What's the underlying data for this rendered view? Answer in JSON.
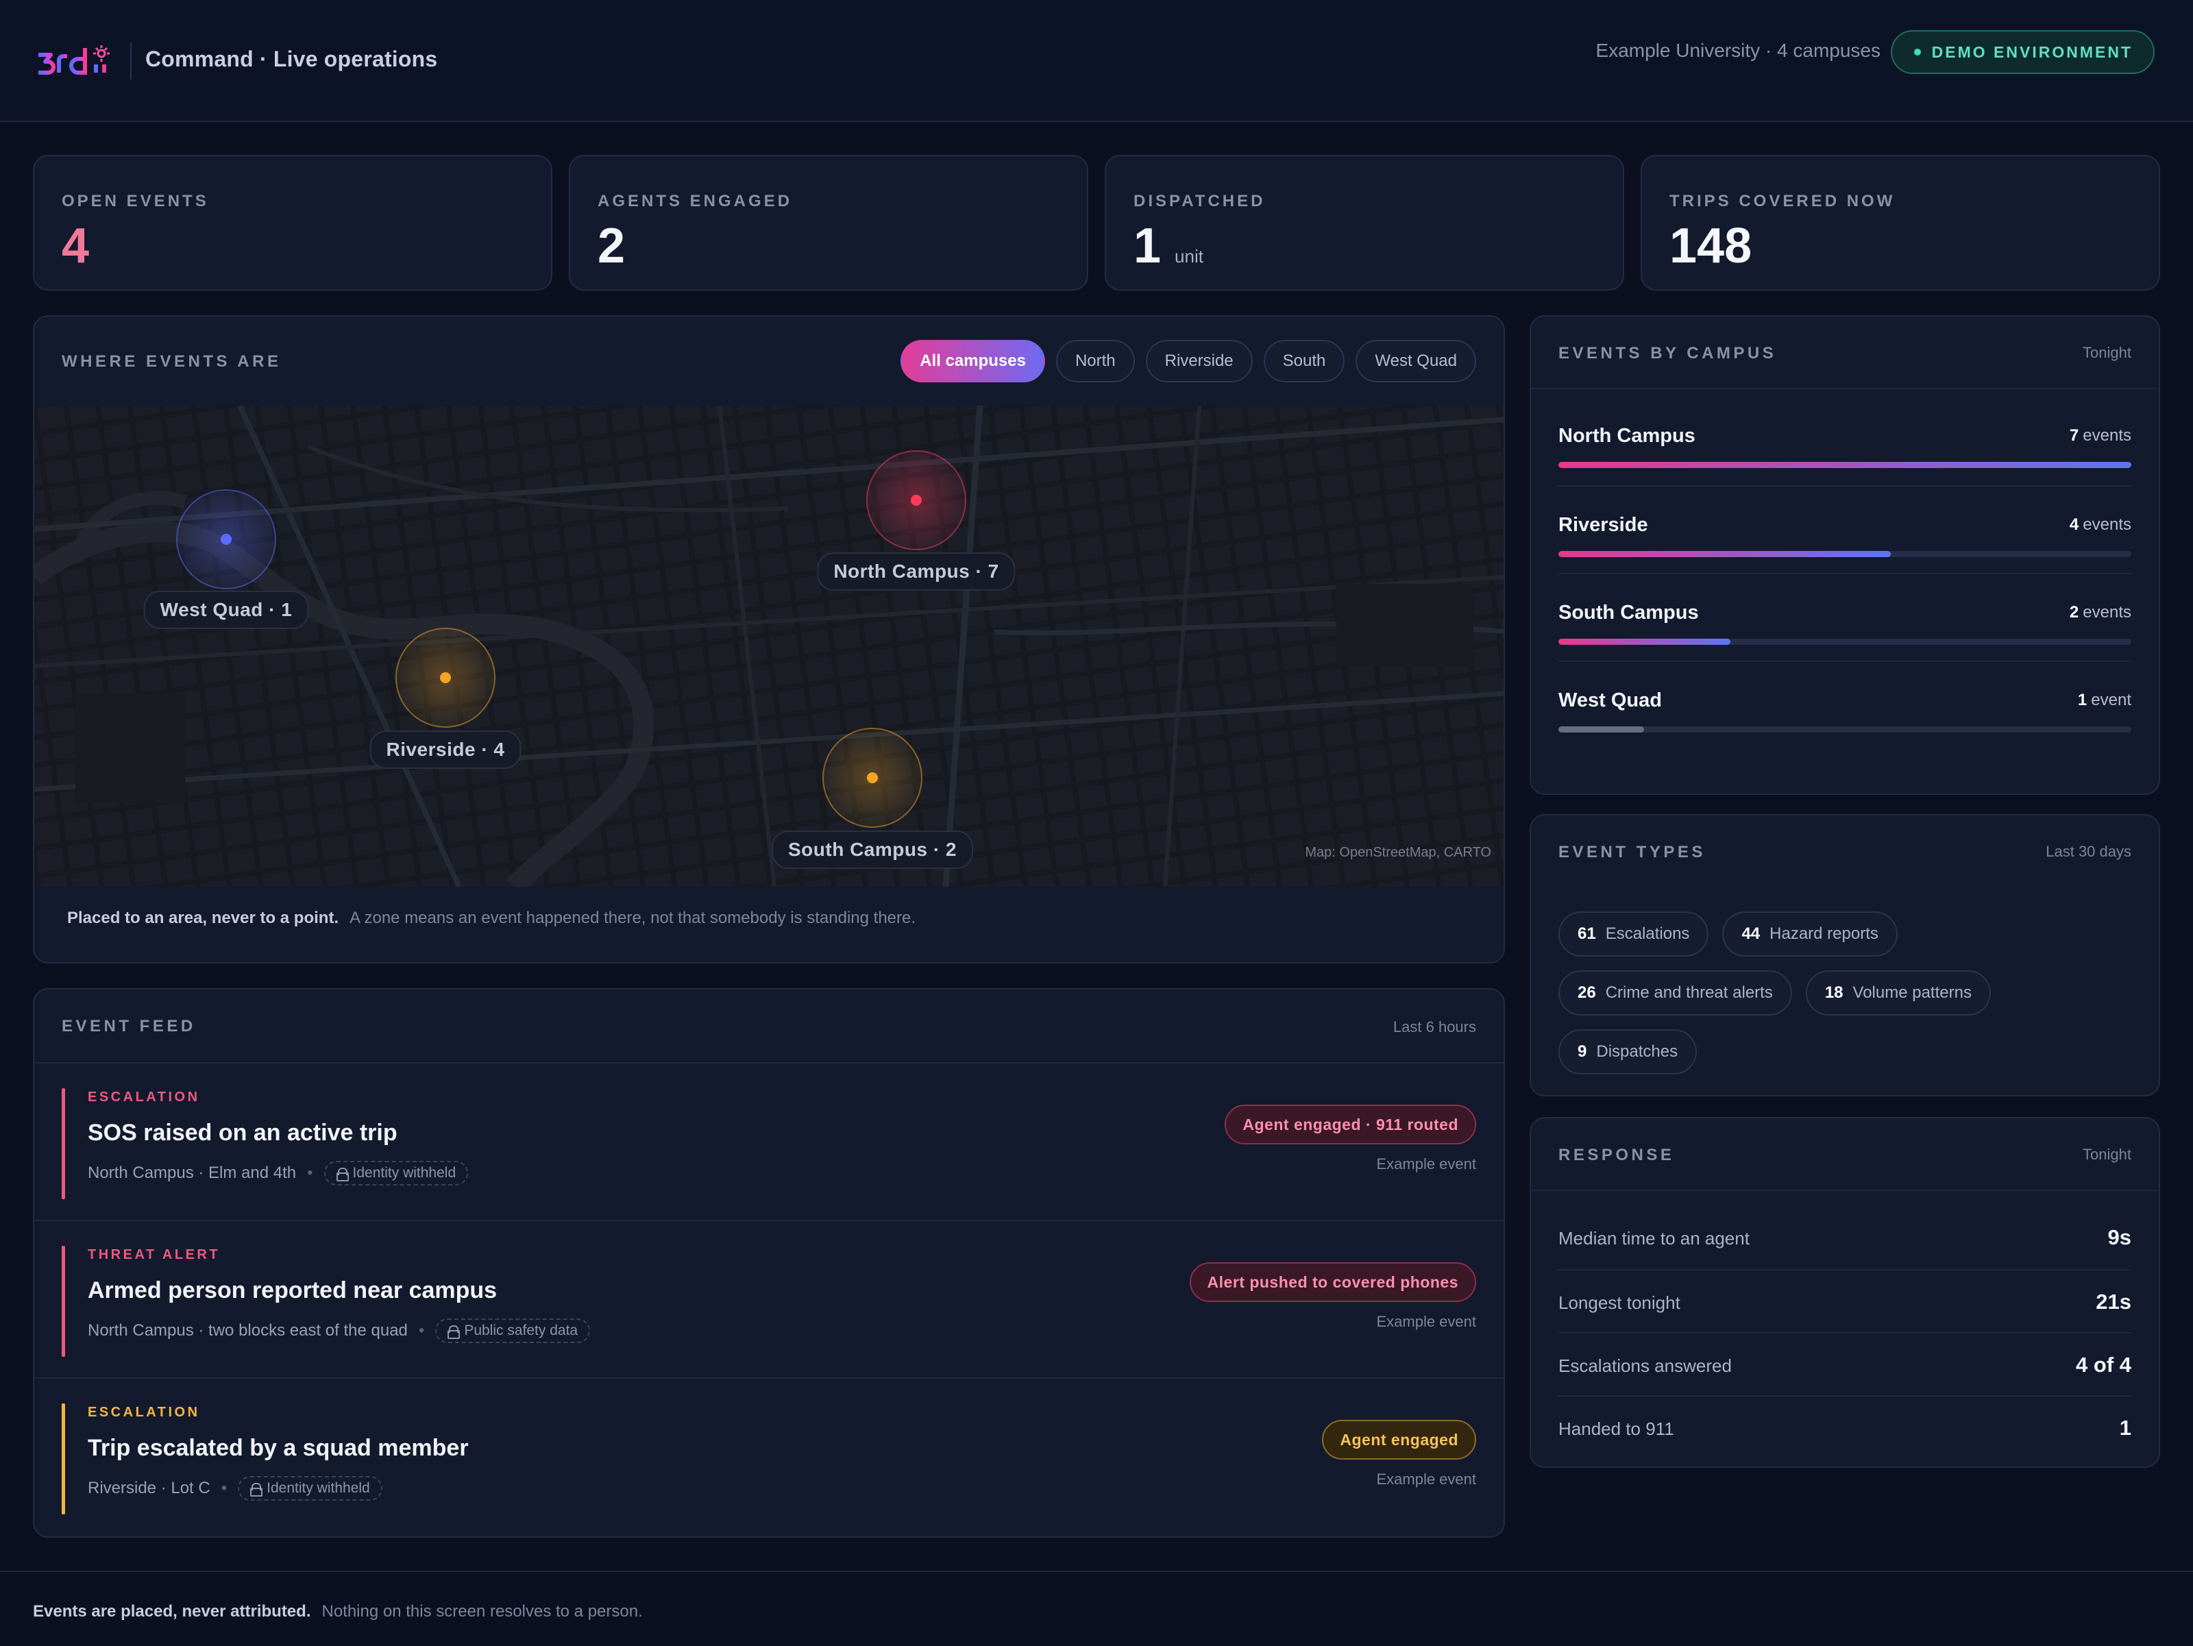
{
  "header": {
    "app_title": "Command · Live operations",
    "org_label": "Example University · 4 campuses",
    "env_badge": "DEMO ENVIRONMENT"
  },
  "kpis": [
    {
      "label": "OPEN EVENTS",
      "value": "4",
      "unit": ""
    },
    {
      "label": "AGENTS ENGAGED",
      "value": "2",
      "unit": ""
    },
    {
      "label": "DISPATCHED",
      "value": "1",
      "unit": "unit"
    },
    {
      "label": "TRIPS COVERED NOW",
      "value": "148",
      "unit": ""
    }
  ],
  "map_section": {
    "title": "WHERE EVENTS ARE",
    "filters": [
      "All campuses",
      "North",
      "Riverside",
      "South",
      "West Quad"
    ],
    "active_filter": "All campuses",
    "zones": [
      {
        "label": "West Quad · 1",
        "color": "#5b6cff"
      },
      {
        "label": "North Campus · 7",
        "color": "#ff3b5c"
      },
      {
        "label": "Riverside · 4",
        "color": "#f5a524"
      },
      {
        "label": "South Campus · 2",
        "color": "#f5a524"
      }
    ],
    "attribution": "Map: OpenStreetMap, CARTO",
    "note_strong": "Placed to an area, never to a point.",
    "note": "A zone means an event happened there, not that somebody is standing there."
  },
  "feed": {
    "title": "EVENT FEED",
    "meta": "Last 6 hours",
    "items": [
      {
        "kind": "ESCALATION",
        "title": "SOS raised on an active trip",
        "location": "North Campus · Elm and 4th",
        "privacy": "Identity withheld",
        "status": "Agent engaged · 911 routed",
        "note": "Example event",
        "accent": "#f0587e"
      },
      {
        "kind": "THREAT ALERT",
        "title": "Armed person reported near campus",
        "location": "North Campus · two blocks east of the quad",
        "privacy": "Public safety data",
        "status": "Alert pushed to covered phones",
        "note": "Example event",
        "accent": "#f0587e"
      },
      {
        "kind": "ESCALATION",
        "title": "Trip escalated by a squad member",
        "location": "Riverside · Lot C",
        "privacy": "Identity withheld",
        "status": "Agent engaged",
        "note": "Example event",
        "accent": "#f5b63f"
      }
    ]
  },
  "by_campus": {
    "title": "EVENTS BY CAMPUS",
    "meta": "Tonight",
    "rows": [
      {
        "name": "North Campus",
        "count": "7",
        "unit": "events",
        "fraction": 1.0
      },
      {
        "name": "Riverside",
        "count": "4",
        "unit": "events",
        "fraction": 0.58
      },
      {
        "name": "South Campus",
        "count": "2",
        "unit": "events",
        "fraction": 0.3
      },
      {
        "name": "West Quad",
        "count": "1",
        "unit": "event",
        "fraction": 0.15
      }
    ]
  },
  "event_types": {
    "title": "EVENT TYPES",
    "meta": "Last 30 days",
    "items": [
      {
        "count": "61",
        "label": "Escalations"
      },
      {
        "count": "44",
        "label": "Hazard reports"
      },
      {
        "count": "26",
        "label": "Crime and threat alerts"
      },
      {
        "count": "18",
        "label": "Volume patterns"
      },
      {
        "count": "9",
        "label": "Dispatches"
      }
    ]
  },
  "response": {
    "title": "RESPONSE",
    "meta": "Tonight",
    "rows": [
      {
        "label": "Median time to an agent",
        "value": "9s"
      },
      {
        "label": "Longest tonight",
        "value": "21s"
      },
      {
        "label": "Escalations answered",
        "value": "4 of 4"
      },
      {
        "label": "Handed to 911",
        "value": "1"
      }
    ]
  },
  "footer": {
    "strong": "Events are placed, never attributed.",
    "text": "Nothing on this screen resolves to a person."
  }
}
